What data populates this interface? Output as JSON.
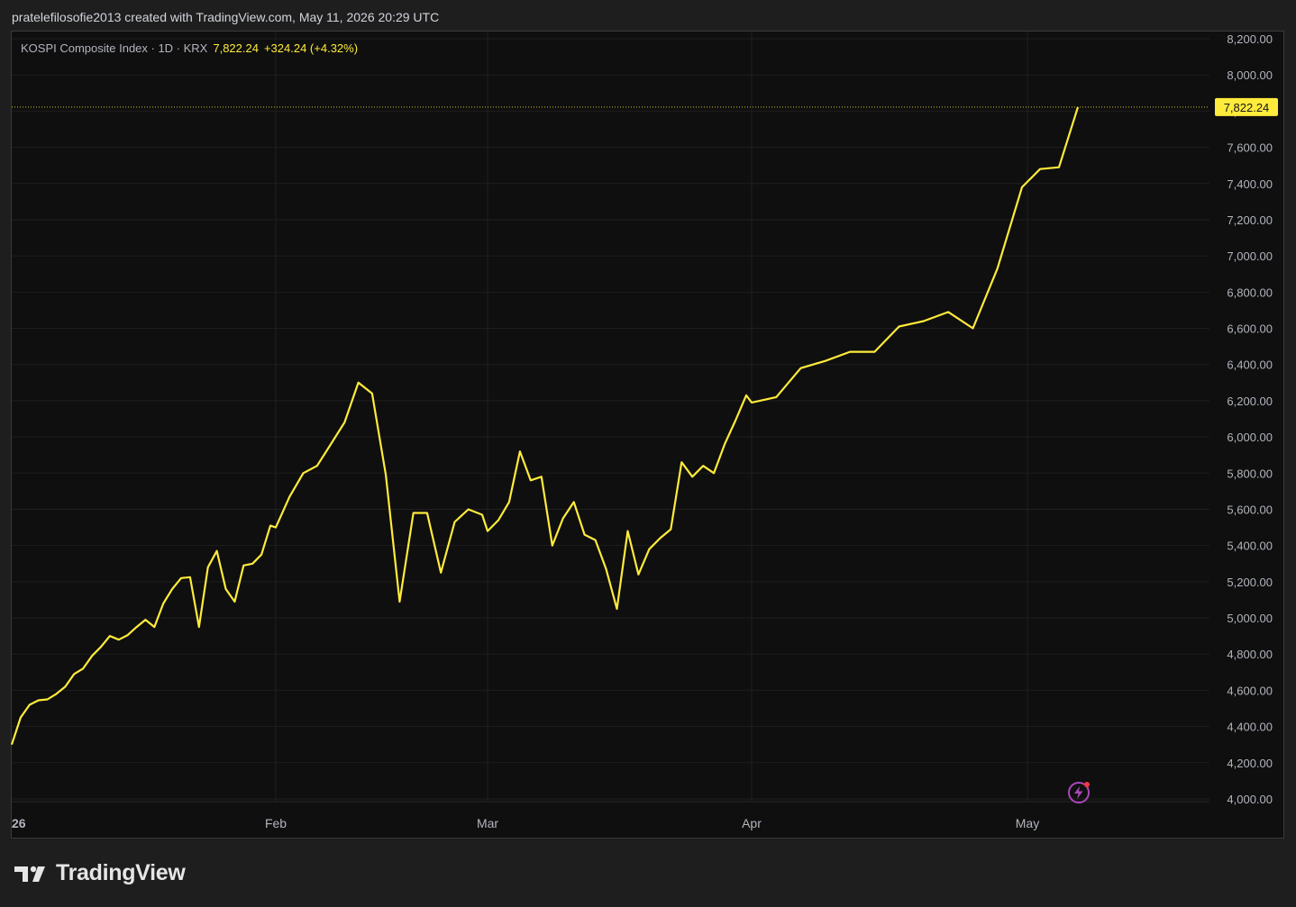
{
  "header": {
    "attribution": "pratelefilosofie2013 created with TradingView.com, May 11, 2026 20:29 UTC"
  },
  "legend": {
    "symbol": "KOSPI Composite Index · 1D · KRX",
    "last": "7,822.24",
    "change": "+324.24 (+4.32%)"
  },
  "price_tag": {
    "label": "7,822.24",
    "value": 7822.24,
    "bg": "#ffeb3b"
  },
  "footer": {
    "brand": "TradingView"
  },
  "alert_icon": "lightning-alert-icon",
  "colors": {
    "line": "#ffeb3b",
    "grid": "#1f1f1f",
    "axis_text": "#b2b5be",
    "chart_bg": "#0f0f0f"
  },
  "chart_data": {
    "type": "line",
    "title": "",
    "xlabel": "",
    "ylabel": "",
    "ylim": [
      4000,
      8200
    ],
    "y_ticks": [
      "4,000.00",
      "4,200.00",
      "4,400.00",
      "4,600.00",
      "4,800.00",
      "5,000.00",
      "5,200.00",
      "5,400.00",
      "5,600.00",
      "5,800.00",
      "6,000.00",
      "6,200.00",
      "6,400.00",
      "6,600.00",
      "6,800.00",
      "7,000.00",
      "7,200.00",
      "7,400.00",
      "7,600.00",
      "7,800.00",
      "8,000.00",
      "8,200.00"
    ],
    "x_ticks": [
      {
        "label": "26",
        "date": "2026-01-01"
      },
      {
        "label": "Feb",
        "date": "2026-02-01"
      },
      {
        "label": "Mar",
        "date": "2026-03-01"
      },
      {
        "label": "Apr",
        "date": "2026-04-01"
      },
      {
        "label": "May",
        "date": "2026-05-01"
      }
    ],
    "grid": true,
    "series": [
      {
        "values": [
          [
            "2026-01-02",
            4300
          ],
          [
            "2026-01-03",
            4450
          ],
          [
            "2026-01-04",
            4520
          ],
          [
            "2026-01-05",
            4545
          ],
          [
            "2026-01-06",
            4550
          ],
          [
            "2026-01-07",
            4580
          ],
          [
            "2026-01-08",
            4620
          ],
          [
            "2026-01-09",
            4690
          ],
          [
            "2026-01-10",
            4720
          ],
          [
            "2026-01-11",
            4790
          ],
          [
            "2026-01-12",
            4840
          ],
          [
            "2026-01-13",
            4900
          ],
          [
            "2026-01-14",
            4880
          ],
          [
            "2026-01-15",
            4905
          ],
          [
            "2026-01-16",
            4950
          ],
          [
            "2026-01-17",
            4990
          ],
          [
            "2026-01-18",
            4950
          ],
          [
            "2026-01-19",
            5080
          ],
          [
            "2026-01-20",
            5160
          ],
          [
            "2026-01-21",
            5220
          ],
          [
            "2026-01-22",
            5225
          ],
          [
            "2026-01-23",
            4950
          ],
          [
            "2026-01-24",
            5280
          ],
          [
            "2026-01-25",
            5370
          ],
          [
            "2026-01-26",
            5160
          ],
          [
            "2026-01-27",
            5090
          ],
          [
            "2026-01-28",
            5290
          ],
          [
            "2026-01-29",
            5300
          ],
          [
            "2026-01-30",
            5350
          ],
          [
            "2026-01-31",
            5510
          ],
          [
            "2026-02-01",
            5500
          ],
          [
            "2026-02-02",
            5670
          ],
          [
            "2026-02-03",
            5800
          ],
          [
            "2026-02-04",
            5840
          ],
          [
            "2026-02-05",
            5960
          ],
          [
            "2026-02-06",
            6080
          ],
          [
            "2026-02-07",
            6300
          ],
          [
            "2026-02-08",
            6240
          ],
          [
            "2026-02-09",
            5790
          ],
          [
            "2026-02-10",
            5090
          ],
          [
            "2026-02-11",
            5580
          ],
          [
            "2026-02-12",
            5580
          ],
          [
            "2026-02-13",
            5250
          ],
          [
            "2026-02-14",
            5530
          ],
          [
            "2026-02-15",
            5600
          ],
          [
            "2026-02-16",
            5570
          ],
          [
            "2026-03-02",
            5480
          ],
          [
            "2026-03-03",
            5540
          ],
          [
            "2026-03-04",
            5640
          ],
          [
            "2026-03-05",
            5920
          ],
          [
            "2026-03-06",
            5760
          ],
          [
            "2026-03-07",
            5780
          ],
          [
            "2026-03-08",
            5400
          ],
          [
            "2026-03-09",
            5550
          ],
          [
            "2026-03-10",
            5640
          ],
          [
            "2026-03-11",
            5460
          ],
          [
            "2026-03-12",
            5430
          ],
          [
            "2026-03-13",
            5270
          ],
          [
            "2026-03-14",
            5050
          ],
          [
            "2026-03-15",
            5480
          ],
          [
            "2026-03-16",
            5240
          ],
          [
            "2026-03-17",
            5380
          ],
          [
            "2026-03-18",
            5440
          ],
          [
            "2026-03-19",
            5490
          ],
          [
            "2026-03-20",
            5860
          ],
          [
            "2026-03-21",
            5780
          ],
          [
            "2026-03-22",
            5840
          ],
          [
            "2026-03-23",
            5800
          ],
          [
            "2026-03-24",
            5960
          ],
          [
            "2026-03-25",
            6090
          ],
          [
            "2026-03-26",
            6230
          ],
          [
            "2026-04-01",
            6190
          ],
          [
            "2026-04-02",
            6220
          ],
          [
            "2026-04-03",
            6380
          ],
          [
            "2026-04-04",
            6420
          ],
          [
            "2026-04-05",
            6470
          ],
          [
            "2026-04-06",
            6470
          ],
          [
            "2026-04-07",
            6610
          ],
          [
            "2026-04-08",
            6640
          ],
          [
            "2026-04-09",
            6690
          ],
          [
            "2026-04-10",
            6600
          ],
          [
            "2026-04-11",
            6930
          ],
          [
            "2026-04-12",
            7380
          ],
          [
            "2026-05-01",
            7480
          ],
          [
            "2026-05-02",
            7490
          ],
          [
            "2026-05-03",
            7822.24
          ]
        ]
      }
    ]
  }
}
